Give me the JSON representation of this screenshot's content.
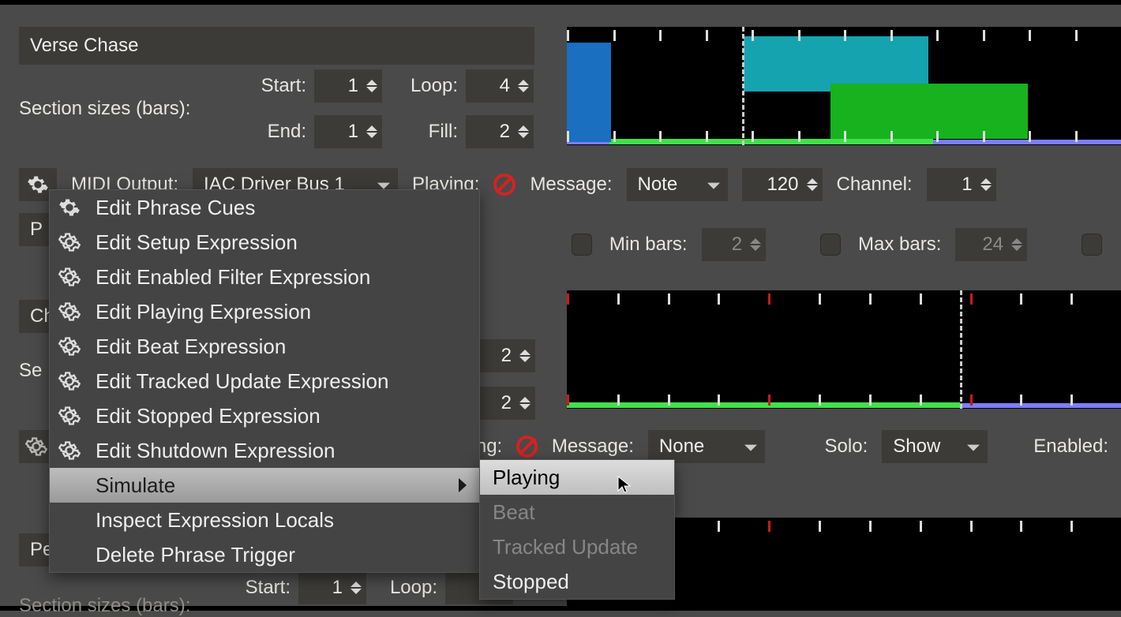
{
  "section1": {
    "name": "Verse Chase",
    "sizes_label": "Section sizes (bars):",
    "start_label": "Start:",
    "end_label": "End:",
    "loop_label": "Loop:",
    "fill_label": "Fill:",
    "start": "1",
    "end": "1",
    "loop": "4",
    "fill": "2",
    "midi_label": "MIDI Output:",
    "midi_value": "IAC Driver Bus 1",
    "playing_label": "Playing:",
    "message_label": "Message:",
    "message_value": "Note",
    "note_num": "120",
    "channel_label": "Channel:",
    "channel_value": "1",
    "min_label": "Min bars:",
    "min_value": "2",
    "max_label": "Max bars:",
    "max_value": "24"
  },
  "section2": {
    "extra_spin1": "2",
    "extra_spin2": "2",
    "playing_suffix": "ing:",
    "message_label": "Message:",
    "message_value": "None",
    "solo_label": "Solo:",
    "solo_value": "Show",
    "enabled_label": "Enabled:"
  },
  "section3": {
    "start_label": "Start:",
    "start": "1",
    "loop_label": "Loop:",
    "sizes_label": "Section sizes (bars):"
  },
  "left_peek": {
    "p": "P",
    "ch": "Ch",
    "pe": "Pe"
  },
  "menu": {
    "items": [
      {
        "icon": "solid",
        "label": "Edit Phrase Cues"
      },
      {
        "icon": "outline",
        "label": "Edit Setup Expression"
      },
      {
        "icon": "outline",
        "label": "Edit Enabled Filter Expression"
      },
      {
        "icon": "outline",
        "label": "Edit Playing Expression"
      },
      {
        "icon": "outline",
        "label": "Edit Beat Expression"
      },
      {
        "icon": "outline",
        "label": "Edit Tracked Update Expression"
      },
      {
        "icon": "outline",
        "label": "Edit Stopped Expression"
      },
      {
        "icon": "outline",
        "label": "Edit Shutdown Expression"
      },
      {
        "icon": null,
        "label": "Simulate",
        "sub": true,
        "hl": true
      },
      {
        "icon": null,
        "label": "Inspect Expression Locals"
      },
      {
        "icon": null,
        "label": "Delete Phrase Trigger"
      }
    ],
    "submenu": [
      {
        "label": "Playing",
        "state": "hl"
      },
      {
        "label": "Beat",
        "state": "dis"
      },
      {
        "label": "Tracked Update",
        "state": "dis"
      },
      {
        "label": "Stopped",
        "state": ""
      }
    ]
  }
}
